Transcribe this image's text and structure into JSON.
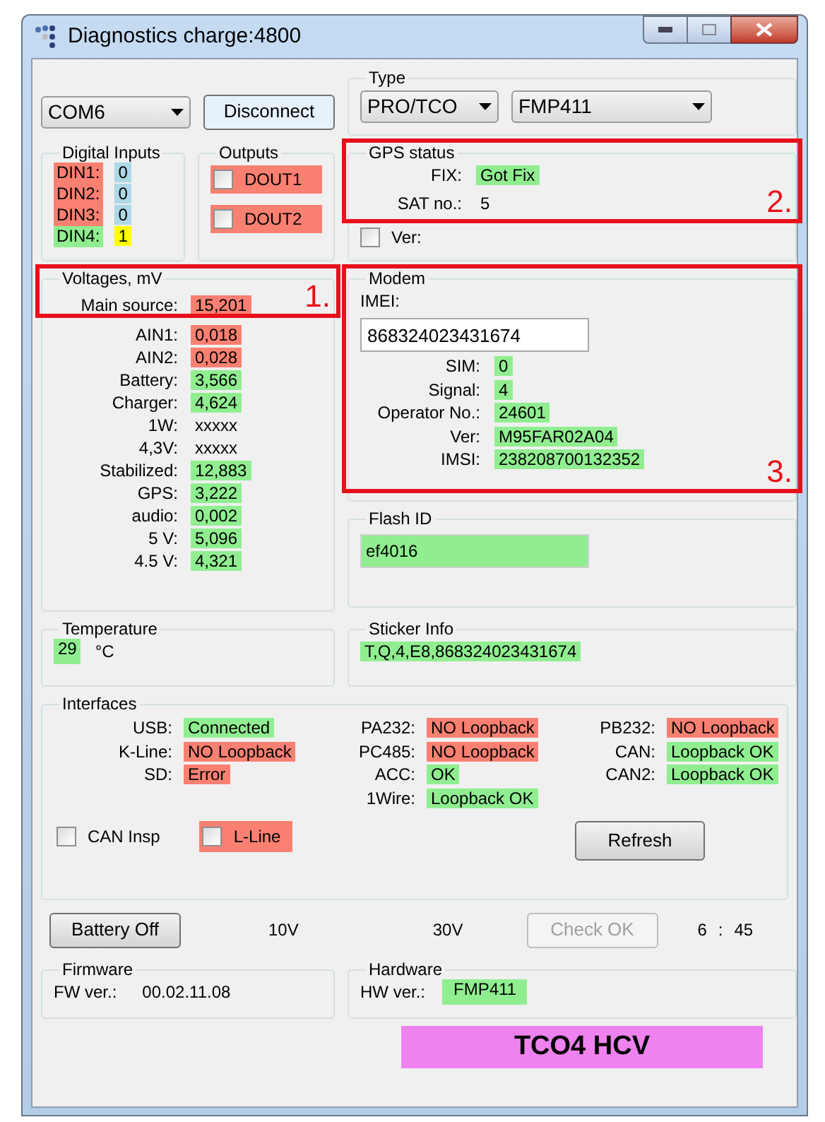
{
  "window": {
    "title": "Diagnostics charge:4800"
  },
  "connection": {
    "port": "COM6",
    "button": "Disconnect"
  },
  "type": {
    "title": "Type",
    "protocol": "PRO/TCO",
    "model": "FMP411"
  },
  "digital_inputs": {
    "title": "Digital Inputs",
    "items": [
      {
        "label": {
          "text": "DIN1:",
          "color": "#fa8072"
        },
        "value": {
          "text": "0",
          "color": "#add8e6"
        }
      },
      {
        "label": {
          "text": "DIN2:",
          "color": "#fa8072"
        },
        "value": {
          "text": "0",
          "color": "#add8e6"
        }
      },
      {
        "label": {
          "text": "DIN3:",
          "color": "#fa8072"
        },
        "value": {
          "text": "0",
          "color": "#add8e6"
        }
      },
      {
        "label": {
          "text": "DIN4:",
          "color": "#90ee90"
        },
        "value": {
          "text": "1",
          "color": "#ffff00"
        }
      }
    ]
  },
  "outputs": {
    "title": "Outputs",
    "items": [
      {
        "label": "DOUT1",
        "checked": false,
        "color": "#fa8072"
      },
      {
        "label": "DOUT2",
        "checked": false,
        "color": "#fa8072"
      }
    ]
  },
  "gps": {
    "title": "GPS status",
    "annotation": "2.",
    "rows": [
      {
        "label": "FIX:",
        "value": "Got Fix",
        "color": "#90ee90"
      },
      {
        "label": "SAT no.:",
        "value": "5"
      }
    ],
    "ver": {
      "label": "Ver:",
      "checked": false
    }
  },
  "voltages": {
    "title": "Voltages, mV",
    "annotation": "1.",
    "rows": [
      {
        "label": "Main source:",
        "value": "15,201",
        "color": "#fa8072"
      },
      {
        "label": "AIN1:",
        "value": "0,018",
        "color": "#fa8072"
      },
      {
        "label": "AIN2:",
        "value": "0,028",
        "color": "#fa8072"
      },
      {
        "label": "Battery:",
        "value": "3,566",
        "color": "#90ee90"
      },
      {
        "label": "Charger:",
        "value": "4,624",
        "color": "#90ee90"
      },
      {
        "label": "1W:",
        "value": "xxxxx"
      },
      {
        "label": "4,3V:",
        "value": "xxxxx"
      },
      {
        "label": "Stabilized:",
        "value": "12,883",
        "color": "#90ee90"
      },
      {
        "label": "GPS:",
        "value": "3,222",
        "color": "#90ee90"
      },
      {
        "label": "audio:",
        "value": "0,002",
        "color": "#90ee90"
      },
      {
        "label": "5 V:",
        "value": "5,096",
        "color": "#90ee90"
      },
      {
        "label": "4.5 V:",
        "value": "4,321",
        "color": "#90ee90"
      }
    ]
  },
  "modem": {
    "title": "Modem",
    "annotation": "3.",
    "imei_label": "IMEI:",
    "imei": "868324023431674",
    "rows": [
      {
        "label": "SIM:",
        "value": "0",
        "color": "#90ee90"
      },
      {
        "label": "Signal:",
        "value": "4",
        "color": "#90ee90"
      },
      {
        "label": "Operator No.:",
        "value": "24601",
        "color": "#90ee90"
      },
      {
        "label": "Ver:",
        "value": "M95FAR02A04",
        "color": "#90ee90"
      },
      {
        "label": "IMSI:",
        "value": "238208700132352",
        "color": "#90ee90"
      }
    ]
  },
  "flash_id": {
    "title": "Flash ID",
    "value": "ef4016",
    "color": "#90ee90"
  },
  "temperature": {
    "title": "Temperature",
    "value": "29",
    "color": "#90ee90",
    "unit": "°C"
  },
  "sticker": {
    "title": "Sticker Info",
    "value": "T,Q,4,E8,868324023431674",
    "color": "#90ee90"
  },
  "interfaces": {
    "title": "Interfaces",
    "columns": [
      [
        {
          "label": "USB:",
          "value": "Connected",
          "color": "#90ee90"
        },
        {
          "label": "K-Line:",
          "value": "NO Loopback",
          "color": "#fa8072"
        },
        {
          "label": "SD:",
          "value": "Error",
          "color": "#fa8072"
        }
      ],
      [
        {
          "label": "PA232:",
          "value": "NO Loopback",
          "color": "#fa8072"
        },
        {
          "label": "PC485:",
          "value": "NO Loopback",
          "color": "#fa8072"
        },
        {
          "label": "ACC:",
          "value": "OK",
          "color": "#90ee90"
        },
        {
          "label": "1Wire:",
          "value": "Loopback OK",
          "color": "#90ee90"
        }
      ],
      [
        {
          "label": "PB232:",
          "value": "NO Loopback",
          "color": "#fa8072"
        },
        {
          "label": "CAN:",
          "value": "Loopback OK",
          "color": "#90ee90"
        },
        {
          "label": "CAN2:",
          "value": "Loopback OK",
          "color": "#90ee90"
        }
      ]
    ],
    "checkboxes": [
      {
        "label": "CAN Insp",
        "checked": false
      },
      {
        "label": "L-Line",
        "checked": false,
        "color": "#fa8072"
      }
    ],
    "refresh": "Refresh"
  },
  "controls": {
    "battery_button": "Battery Off",
    "readings": [
      "10V",
      "30V"
    ],
    "check_button": {
      "label": "Check OK",
      "disabled": true
    },
    "time": [
      "6",
      ":",
      "45"
    ]
  },
  "firmware": {
    "title": "Firmware",
    "label": "FW ver.:",
    "value": "00.02.11.08"
  },
  "hardware": {
    "title": "Hardware",
    "label": "HW ver.:",
    "value": "FMP411",
    "color": "#90ee90"
  },
  "banner": {
    "text": "TCO4 HCV",
    "color": "#ee82ee"
  }
}
